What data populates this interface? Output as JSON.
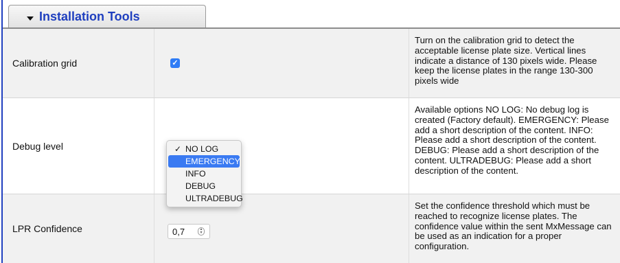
{
  "panel": {
    "title": "Installation Tools"
  },
  "rows": [
    {
      "label": "Calibration grid",
      "checked": true,
      "description": "Turn on the calibration grid to detect the acceptable license plate size. Vertical lines indicate a distance of 130 pixels wide. Please keep the license plates in the range 130-300 pixels wide"
    },
    {
      "label": "Debug level",
      "description": "Available options NO LOG: No debug log is created (Factory default). EMERGENCY: Please add a short description of the content. INFO: Please add a short description of the content. DEBUG: Please add a short description of the content. ULTRADEBUG: Please add a short description of the content."
    },
    {
      "label": "LPR Confidence",
      "value": "0,7",
      "description": "Set the confidence threshold which must be reached to recognize license plates. The confidence value within the sent MxMessage can be used as an indication for a proper configuration."
    }
  ],
  "dropdown": {
    "options": [
      "NO LOG",
      "EMERGENCY",
      "INFO",
      "DEBUG",
      "ULTRADEBUG"
    ],
    "selected": "NO LOG",
    "highlighted": "EMERGENCY",
    "check_glyph": "✓"
  },
  "icons": {
    "caret": "caret-down-icon",
    "checkbox_check": "✓",
    "spinner": "⌃⌄"
  },
  "colors": {
    "accent": "#1f3fbf",
    "highlight": "#3a7af2",
    "checkbox": "#2f7cf6"
  }
}
